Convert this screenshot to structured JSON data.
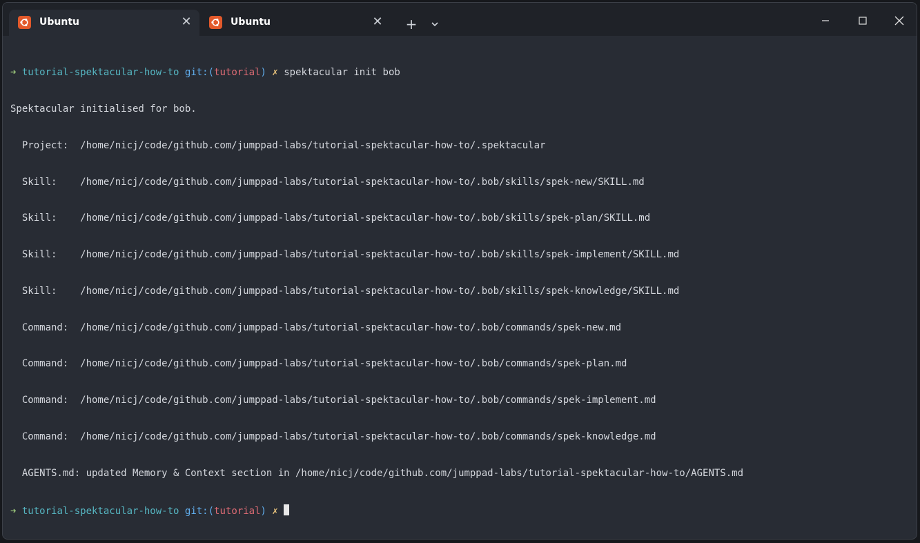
{
  "tabs": [
    {
      "title": "Ubuntu",
      "icon": "ubuntu-icon",
      "active": true
    },
    {
      "title": "Ubuntu",
      "icon": "ubuntu-icon",
      "active": false
    }
  ],
  "prompt": {
    "arrow": "➜",
    "directory": "tutorial-spektacular-how-to",
    "git_prefix": "git:(",
    "branch": "tutorial",
    "git_suffix": ")",
    "dirty_marker": "✗"
  },
  "command": "spektacular init bob",
  "output_lines": [
    "Spektacular initialised for bob.",
    "  Project:  /home/nicj/code/github.com/jumppad-labs/tutorial-spektacular-how-to/.spektacular",
    "  Skill:    /home/nicj/code/github.com/jumppad-labs/tutorial-spektacular-how-to/.bob/skills/spek-new/SKILL.md",
    "  Skill:    /home/nicj/code/github.com/jumppad-labs/tutorial-spektacular-how-to/.bob/skills/spek-plan/SKILL.md",
    "  Skill:    /home/nicj/code/github.com/jumppad-labs/tutorial-spektacular-how-to/.bob/skills/spek-implement/SKILL.md",
    "  Skill:    /home/nicj/code/github.com/jumppad-labs/tutorial-spektacular-how-to/.bob/skills/spek-knowledge/SKILL.md",
    "  Command:  /home/nicj/code/github.com/jumppad-labs/tutorial-spektacular-how-to/.bob/commands/spek-new.md",
    "  Command:  /home/nicj/code/github.com/jumppad-labs/tutorial-spektacular-how-to/.bob/commands/spek-plan.md",
    "  Command:  /home/nicj/code/github.com/jumppad-labs/tutorial-spektacular-how-to/.bob/commands/spek-implement.md",
    "  Command:  /home/nicj/code/github.com/jumppad-labs/tutorial-spektacular-how-to/.bob/commands/spek-knowledge.md",
    "  AGENTS.md: updated Memory & Context section in /home/nicj/code/github.com/jumppad-labs/tutorial-spektacular-how-to/AGENTS.md"
  ],
  "controls": {
    "close_tab": "✕",
    "new_tab": "+",
    "icons": [
      "chevron-down-icon",
      "minimize-icon",
      "maximize-icon",
      "close-icon"
    ]
  },
  "colors": {
    "background": "#282c34",
    "titlebar": "#1f2228",
    "prompt_arrow": "#98c379",
    "directory": "#56b6c2",
    "git": "#61afef",
    "branch": "#e06c75",
    "dirty": "#e5c07b"
  }
}
